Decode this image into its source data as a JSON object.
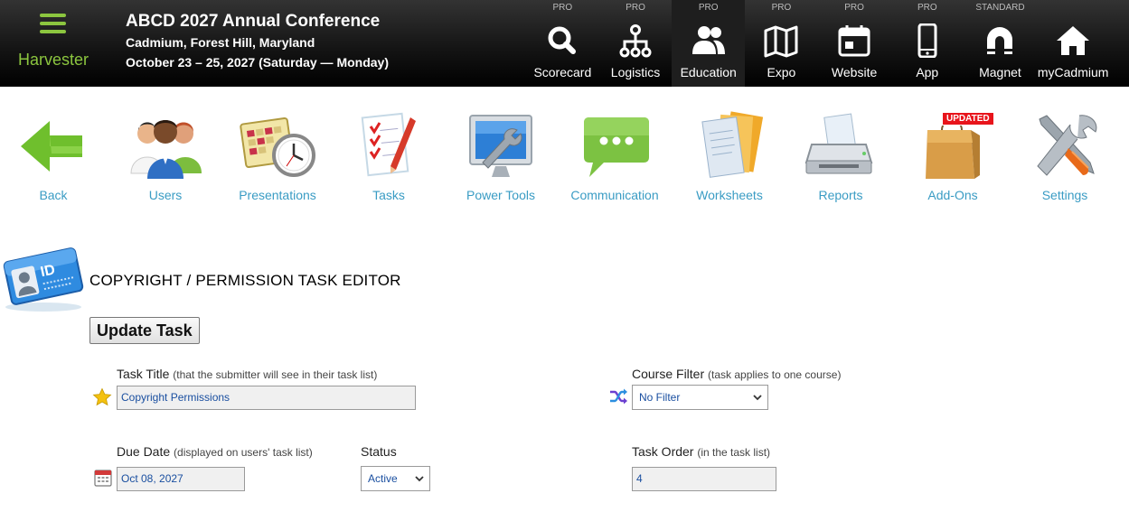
{
  "brand": {
    "name": "Harvester",
    "menu_icon": "hamburger-menu-icon"
  },
  "event": {
    "title": "ABCD 2027 Annual Conference",
    "location": "Cadmium, Forest Hill, Maryland",
    "dates": "October 23 – 25, 2027 (Saturday — Monday)"
  },
  "nav": [
    {
      "tier": "PRO",
      "label": "Scorecard",
      "icon": "search-icon"
    },
    {
      "tier": "PRO",
      "label": "Logistics",
      "icon": "hierarchy-icon"
    },
    {
      "tier": "PRO",
      "label": "Education",
      "icon": "people-icon",
      "active": true
    },
    {
      "tier": "PRO",
      "label": "Expo",
      "icon": "map-icon"
    },
    {
      "tier": "PRO",
      "label": "Website",
      "icon": "calendar-icon"
    },
    {
      "tier": "PRO",
      "label": "App",
      "icon": "phone-icon"
    },
    {
      "tier": "STANDARD",
      "label": "Magnet",
      "icon": "magnet-icon"
    },
    {
      "tier": "",
      "label": "myCadmium",
      "icon": "home-icon"
    }
  ],
  "tools": [
    {
      "label": "Back",
      "icon": "back-arrow-icon"
    },
    {
      "label": "Users",
      "icon": "users-icon"
    },
    {
      "label": "Presentations",
      "icon": "schedule-clock-icon"
    },
    {
      "label": "Tasks",
      "icon": "checklist-icon"
    },
    {
      "label": "Power Tools",
      "icon": "monitor-wrench-icon"
    },
    {
      "label": "Communication",
      "icon": "chat-bubble-icon"
    },
    {
      "label": "Worksheets",
      "icon": "documents-icon"
    },
    {
      "label": "Reports",
      "icon": "printer-icon"
    },
    {
      "label": "Add-Ons",
      "icon": "shopping-bag-icon",
      "badge": "UPDATED"
    },
    {
      "label": "Settings",
      "icon": "wrench-screwdriver-icon"
    }
  ],
  "editor": {
    "title": "COPYRIGHT / PERMISSION TASK EDITOR",
    "update_button": "Update Task"
  },
  "form": {
    "task_title": {
      "label": "Task Title",
      "hint": "(that the submitter will see in their task list)",
      "value": "Copyright Permissions"
    },
    "course_filter": {
      "label": "Course Filter",
      "hint": "(task applies to one course)",
      "value": "No Filter"
    },
    "due_date": {
      "label": "Due Date",
      "hint": "(displayed on users' task list)",
      "value": "Oct 08, 2027"
    },
    "status": {
      "label": "Status",
      "value": "Active"
    },
    "task_order": {
      "label": "Task Order",
      "hint": "(in the task list)",
      "value": "4"
    }
  },
  "colors": {
    "accent_green": "#8cc63f",
    "link_blue": "#3a9cc4",
    "badge_red": "#e8141b"
  }
}
